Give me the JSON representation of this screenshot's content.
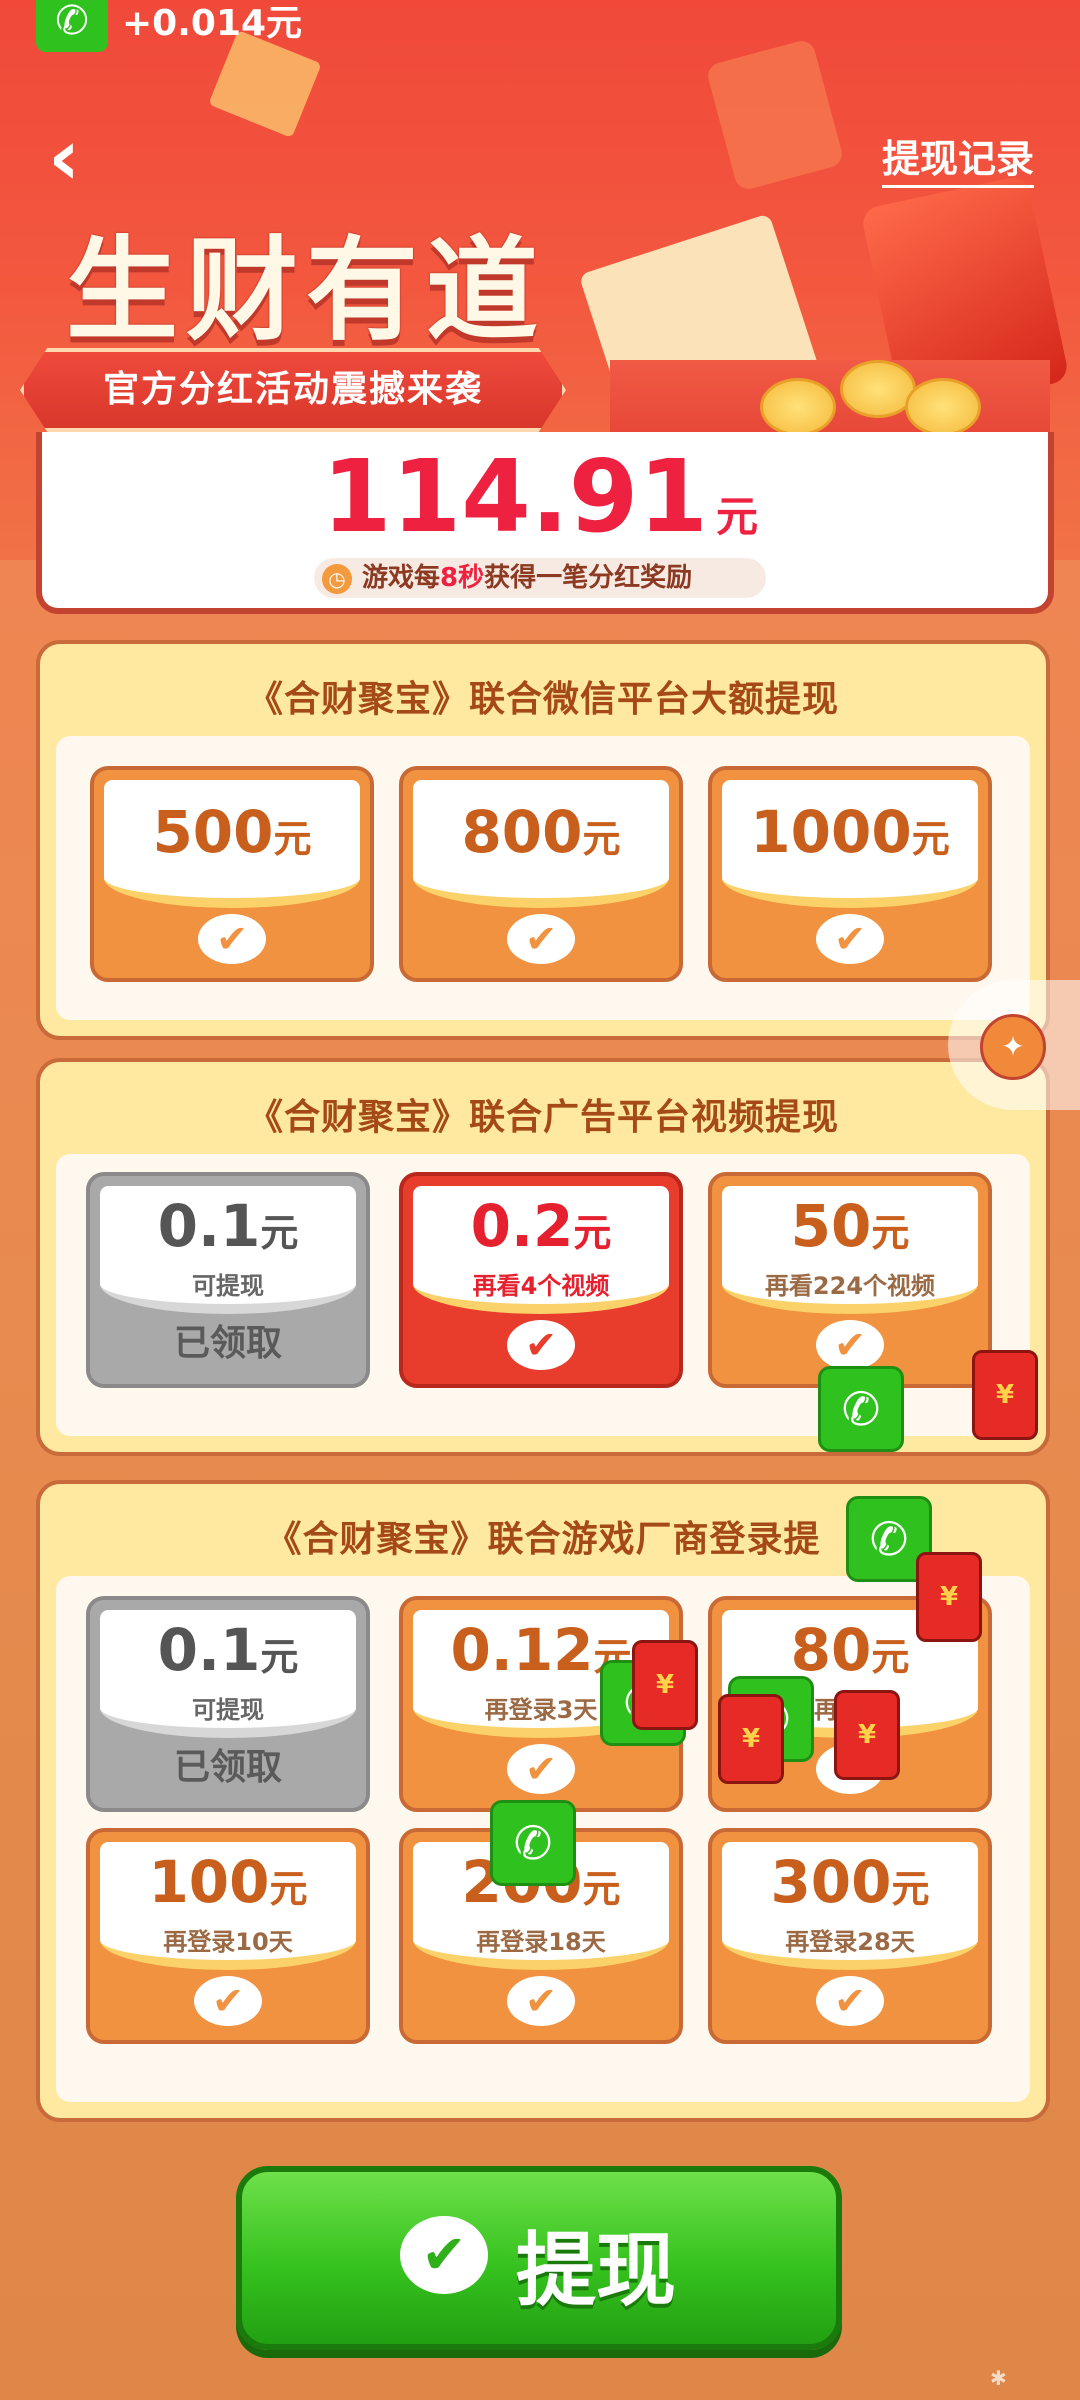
{
  "status": {
    "reward_delta": "+0.014元"
  },
  "header": {
    "back_icon": "chevron-left-icon",
    "records_label": "提现记录",
    "title": "生财有道",
    "subtitle": "官方分红活动震撼来袭"
  },
  "balance": {
    "amount": "114.91",
    "unit": "元",
    "tip_prefix": "游戏每",
    "tip_highlight": "8秒",
    "tip_suffix": "获得一笔分红奖励"
  },
  "sections": [
    {
      "title": "《合财聚宝》联合微信平台大额提现",
      "tiles": [
        {
          "amount": "500",
          "unit": "元"
        },
        {
          "amount": "800",
          "unit": "元"
        },
        {
          "amount": "1000",
          "unit": "元"
        }
      ]
    },
    {
      "title": "《合财聚宝》联合广告平台视频提现",
      "tiles": [
        {
          "amount": "0.1",
          "unit": "元",
          "sub": "可提现",
          "status": "已领取"
        },
        {
          "amount": "0.2",
          "unit": "元",
          "sub": "再看4个视频"
        },
        {
          "amount": "50",
          "unit": "元",
          "sub": "再看224个视频"
        }
      ]
    },
    {
      "title": "《合财聚宝》联合游戏厂商登录提",
      "tiles": [
        {
          "amount": "0.1",
          "unit": "元",
          "sub": "可提现",
          "status": "已领取"
        },
        {
          "amount": "0.12",
          "unit": "元",
          "sub": "再登录3天"
        },
        {
          "amount": "80",
          "unit": "元",
          "sub": "再登录"
        },
        {
          "amount": "100",
          "unit": "元",
          "sub": "再登录10天"
        },
        {
          "amount": "200",
          "unit": "元",
          "sub": "再登录18天"
        },
        {
          "amount": "300",
          "unit": "元",
          "sub": "再登录28天"
        }
      ]
    }
  ],
  "withdraw": {
    "label": "提现",
    "icon": "wechat-pay-icon"
  },
  "float_envelope_glyph": "¥",
  "colors": {
    "accent_red": "#ee2140",
    "button_green": "#36c21e",
    "tile_orange": "#f0923f",
    "claimed_grey": "#a9a9a9"
  }
}
